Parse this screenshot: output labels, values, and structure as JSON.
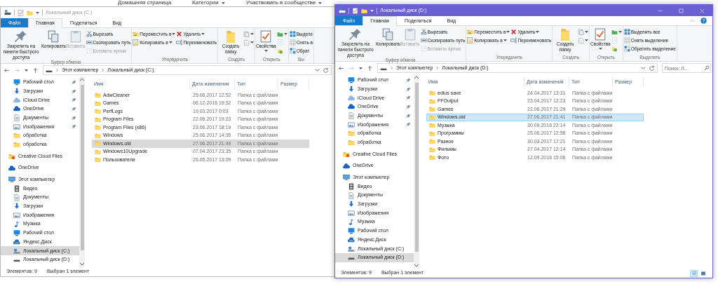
{
  "background_page": {
    "links": [
      {
        "label": "Домашняя страница",
        "dropdown": false
      },
      {
        "label": "Категории",
        "dropdown": true
      },
      {
        "label": "Участвовать в сообществе",
        "dropdown": true
      }
    ]
  },
  "windows": [
    {
      "title": "Локальный диск (C:)",
      "active": false,
      "caption_buttons": false,
      "tabs": [
        {
          "label": "Файл",
          "kind": "file",
          "selected": false
        },
        {
          "label": "Главная",
          "kind": "tab",
          "selected": true
        },
        {
          "label": "Поделиться",
          "kind": "tab",
          "selected": false
        },
        {
          "label": "Вид",
          "kind": "tab",
          "selected": false
        }
      ],
      "ribbon": {
        "groups": [
          {
            "label": "Буфер обмена",
            "columns": [
              [
                {
                  "kind": "pin",
                  "label": "Закрепить на панели быстрого доступа",
                  "disabled": false,
                  "dropdown": false
                }
              ],
              [
                {
                  "kind": "copy",
                  "label": "Копировать",
                  "disabled": false,
                  "dropdown": false
                }
              ],
              [
                {
                  "kind": "paste",
                  "label": "Вставить",
                  "disabled": true,
                  "dropdown": false
                }
              ],
              [
                {
                  "kind": "cut",
                  "label": "Вырезать",
                  "disabled": false,
                  "dropdown": false
                },
                {
                  "kind": "copypath",
                  "label": "Скопировать путь",
                  "disabled": false,
                  "dropdown": false
                },
                {
                  "kind": "shortcut",
                  "label": "Вставить ярлык",
                  "disabled": true,
                  "dropdown": false
                }
              ]
            ]
          },
          {
            "label": "Упорядочить",
            "columns": [
              [
                {
                  "kind": "move",
                  "label": "Переместить в",
                  "disabled": false,
                  "dropdown": true
                },
                {
                  "kind": "copyto",
                  "label": "Копировать в",
                  "disabled": false,
                  "dropdown": true
                }
              ],
              [
                {
                  "kind": "delete",
                  "label": "Удалить",
                  "disabled": false,
                  "dropdown": true
                },
                {
                  "kind": "rename",
                  "label": "Переименовать",
                  "disabled": false,
                  "dropdown": false
                }
              ]
            ]
          },
          {
            "label": "Создать",
            "columns": [
              [
                {
                  "kind": "newfolder",
                  "label": "Создать папку",
                  "disabled": false,
                  "dropdown": false
                }
              ],
              [
                {
                  "kind": "newitem",
                  "disabled": false,
                  "dropdown": true
                },
                {
                  "kind": "easyaccess",
                  "disabled": false,
                  "dropdown": true
                }
              ]
            ]
          },
          {
            "label": "Открыть",
            "columns": [
              [
                {
                  "kind": "properties",
                  "label": "Свойства",
                  "disabled": false,
                  "dropdown": true
                }
              ],
              [
                {
                  "kind": "open",
                  "disabled": false,
                  "dropdown": true
                },
                {
                  "kind": "edit",
                  "disabled": true,
                  "dropdown": false
                },
                {
                  "kind": "history",
                  "disabled": false,
                  "dropdown": false
                }
              ]
            ]
          },
          {
            "label": "Вы",
            "columns": [
              [
                {
                  "kind": "selectall",
                  "label": "Выделе",
                  "disabled": false,
                  "dropdown": false
                },
                {
                  "kind": "selectnone",
                  "label": "Снять в",
                  "disabled": false,
                  "dropdown": false
                },
                {
                  "kind": "invert",
                  "label": "Обрат",
                  "disabled": false,
                  "dropdown": false
                }
              ]
            ]
          }
        ]
      },
      "address": {
        "path": [
          "Этот компьютер",
          "Локальный диск (C:)"
        ]
      },
      "navigation": {
        "quick_access": [
          {
            "label": "Рабочий стол",
            "kind": "desktop",
            "pinned": true,
            "selected": false
          },
          {
            "label": "Загрузки",
            "kind": "downloads",
            "pinned": true,
            "selected": false
          },
          {
            "label": "iCloud Drive",
            "kind": "icloud",
            "pinned": true,
            "selected": false
          },
          {
            "label": "OneDrive",
            "kind": "onedrive",
            "pinned": true,
            "selected": false
          },
          {
            "label": "Документы",
            "kind": "documents",
            "pinned": true,
            "selected": false
          },
          {
            "label": "Изображения",
            "kind": "pictures",
            "pinned": true,
            "selected": false
          },
          {
            "label": "обработка",
            "kind": "folder",
            "pinned": false,
            "selected": false
          },
          {
            "label": "обработка",
            "kind": "folder",
            "pinned": false,
            "selected": false
          }
        ],
        "roots": [
          {
            "label": "Creative Cloud Files",
            "kind": "creativecloud",
            "selected": false
          },
          {
            "label": "OneDrive",
            "kind": "onedrive",
            "selected": false
          },
          {
            "label": "Этот компьютер",
            "kind": "computer",
            "selected": false,
            "children": [
              {
                "label": "Видео",
                "kind": "video",
                "selected": false
              },
              {
                "label": "Документы",
                "kind": "documents",
                "selected": false
              },
              {
                "label": "Загрузки",
                "kind": "downloads",
                "selected": false
              },
              {
                "label": "Изображения",
                "kind": "pictures",
                "selected": false
              },
              {
                "label": "Музыка",
                "kind": "music",
                "selected": false
              },
              {
                "label": "Рабочий стол",
                "kind": "desktop",
                "selected": false
              },
              {
                "label": "Яндекс.Диск",
                "kind": "yandex",
                "selected": false
              },
              {
                "label": "Локальный диск (C:)",
                "kind": "systemdrive",
                "selected": true
              },
              {
                "label": "Локальный диск (D:)",
                "kind": "drive",
                "selected": false
              }
            ]
          }
        ]
      },
      "files": {
        "columns": [
          "Имя",
          "Дата изменения",
          "Тип",
          "Размер"
        ],
        "rows": [
          {
            "name": "AdwCleaner",
            "date": "25.06.2017 12:52",
            "type": "Папка с файлами",
            "selected": false
          },
          {
            "name": "Games",
            "date": "06.12.2016 19:32",
            "type": "Папка с файлами",
            "selected": false
          },
          {
            "name": "PerfLogs",
            "date": "19.03.2017 0:03",
            "type": "Папка с файлами",
            "selected": false
          },
          {
            "name": "Program Files",
            "date": "22.06.2017 19:23",
            "type": "Папка с файлами",
            "selected": false
          },
          {
            "name": "Program Files (x86)",
            "date": "23.06.2017 18:19",
            "type": "Папка с файлами",
            "selected": false
          },
          {
            "name": "Windows",
            "date": "25.06.2017 14:35",
            "type": "Папка с файлами",
            "selected": false
          },
          {
            "name": "Windows.old",
            "date": "27.06.2017 21:49",
            "type": "Папка с файлами",
            "selected": true
          },
          {
            "name": "Windows10Upgrade",
            "date": "07.04.2017 23:35",
            "type": "Папка с файлами",
            "selected": false
          },
          {
            "name": "Пользователи",
            "date": "26.05.2017 13:09",
            "type": "Папка с файлами",
            "selected": false
          }
        ]
      },
      "status": {
        "count": "Элементов: 9",
        "selection": "Выбран 1 элемент"
      }
    },
    {
      "title": "Локальный диск (D:)",
      "active": true,
      "caption_buttons": true,
      "tabs": [
        {
          "label": "Файл",
          "kind": "file",
          "selected": false
        },
        {
          "label": "Главная",
          "kind": "tab",
          "selected": true
        },
        {
          "label": "Поделиться",
          "kind": "tab",
          "selected": false
        },
        {
          "label": "Вид",
          "kind": "tab",
          "selected": false
        }
      ],
      "ribbon": {
        "groups": [
          {
            "label": "Буфер обмена",
            "columns": [
              [
                {
                  "kind": "pin",
                  "label": "Закрепить на панели быстрого доступа",
                  "disabled": false,
                  "dropdown": false
                }
              ],
              [
                {
                  "kind": "copy",
                  "label": "Копировать",
                  "disabled": false,
                  "dropdown": false
                }
              ],
              [
                {
                  "kind": "paste",
                  "label": "Вставить",
                  "disabled": true,
                  "dropdown": false
                }
              ],
              [
                {
                  "kind": "cut",
                  "label": "Вырезать",
                  "disabled": false,
                  "dropdown": false
                },
                {
                  "kind": "copypath",
                  "label": "Скопировать путь",
                  "disabled": false,
                  "dropdown": false
                },
                {
                  "kind": "shortcut",
                  "label": "Вставить ярлык",
                  "disabled": true,
                  "dropdown": false
                }
              ]
            ]
          },
          {
            "label": "Упорядочить",
            "columns": [
              [
                {
                  "kind": "move",
                  "label": "Переместить в",
                  "disabled": false,
                  "dropdown": true
                },
                {
                  "kind": "copyto",
                  "label": "Копировать в",
                  "disabled": false,
                  "dropdown": true
                }
              ],
              [
                {
                  "kind": "delete",
                  "label": "Удалить",
                  "disabled": false,
                  "dropdown": true
                },
                {
                  "kind": "rename",
                  "label": "Переименовать",
                  "disabled": false,
                  "dropdown": false
                }
              ]
            ]
          },
          {
            "label": "Создать",
            "columns": [
              [
                {
                  "kind": "newfolder",
                  "label": "Создать папку",
                  "disabled": false,
                  "dropdown": false
                }
              ],
              [
                {
                  "kind": "newitem",
                  "disabled": false,
                  "dropdown": true
                },
                {
                  "kind": "easyaccess",
                  "disabled": false,
                  "dropdown": true
                }
              ]
            ]
          },
          {
            "label": "Открыть",
            "columns": [
              [
                {
                  "kind": "properties",
                  "label": "Свойства",
                  "disabled": false,
                  "dropdown": true
                }
              ],
              [
                {
                  "kind": "open",
                  "disabled": false,
                  "dropdown": true
                },
                {
                  "kind": "edit",
                  "disabled": true,
                  "dropdown": false
                },
                {
                  "kind": "history",
                  "disabled": false,
                  "dropdown": false
                }
              ]
            ]
          },
          {
            "label": "Выделить",
            "columns": [
              [
                {
                  "kind": "selectall",
                  "label": "Выделить все",
                  "disabled": false,
                  "dropdown": false
                },
                {
                  "kind": "selectnone",
                  "label": "Снять выделение",
                  "disabled": false,
                  "dropdown": false
                },
                {
                  "kind": "invert",
                  "label": "Обратить выделение",
                  "disabled": false,
                  "dropdown": false
                }
              ]
            ]
          }
        ]
      },
      "address": {
        "path": [
          "Этот компьютер",
          "Локальный диск (D:)"
        ]
      },
      "search": {
        "placeholder": "Поиск: Л..."
      },
      "navigation": {
        "quick_access": [
          {
            "label": "Рабочий стол",
            "kind": "desktop",
            "pinned": true,
            "selected": false
          },
          {
            "label": "Загрузки",
            "kind": "downloads",
            "pinned": true,
            "selected": false
          },
          {
            "label": "iCloud Drive",
            "kind": "icloud",
            "pinned": true,
            "selected": false
          },
          {
            "label": "OneDrive",
            "kind": "onedrive",
            "pinned": true,
            "selected": false
          },
          {
            "label": "Документы",
            "kind": "documents",
            "pinned": true,
            "selected": false
          },
          {
            "label": "Изображения",
            "kind": "pictures",
            "pinned": true,
            "selected": false
          },
          {
            "label": "обработка",
            "kind": "folder",
            "pinned": false,
            "selected": false
          },
          {
            "label": "обработка",
            "kind": "folder",
            "pinned": false,
            "selected": false
          }
        ],
        "roots": [
          {
            "label": "Creative Cloud Files",
            "kind": "creativecloud",
            "selected": false
          },
          {
            "label": "OneDrive",
            "kind": "onedrive",
            "selected": false
          },
          {
            "label": "Этот компьютер",
            "kind": "computer",
            "selected": false,
            "children": [
              {
                "label": "Видео",
                "kind": "video",
                "selected": false
              },
              {
                "label": "Документы",
                "kind": "documents",
                "selected": false
              },
              {
                "label": "Загрузки",
                "kind": "downloads",
                "selected": false
              },
              {
                "label": "Изображения",
                "kind": "pictures",
                "selected": false
              },
              {
                "label": "Музыка",
                "kind": "music",
                "selected": false
              },
              {
                "label": "Рабочий стол",
                "kind": "desktop",
                "selected": false
              },
              {
                "label": "Яндекс.Диск",
                "kind": "yandex",
                "selected": false
              },
              {
                "label": "Локальный диск (C:)",
                "kind": "systemdrive",
                "selected": false
              },
              {
                "label": "Локальный диск (D:)",
                "kind": "drive",
                "selected": true
              }
            ]
          }
        ]
      },
      "files": {
        "columns": [
          "Имя",
          "Дата изменения",
          "Тип",
          "Размер"
        ],
        "rows": [
          {
            "name": "edius save",
            "date": "24.04.2017 13:31",
            "type": "Папка с файлами",
            "selected": false
          },
          {
            "name": "FFOutput",
            "date": "23.04.2017 12:23",
            "type": "Папка с файлами",
            "selected": false
          },
          {
            "name": "Games",
            "date": "22.06.2017 21:29",
            "type": "Папка с файлами",
            "selected": false
          },
          {
            "name": "Windows.old",
            "date": "27.06.2017 21:41",
            "type": "Папка с файлами",
            "selected": true
          },
          {
            "name": "Музыка",
            "date": "30.09.2016 22:14",
            "type": "Папка с файлами",
            "selected": false
          },
          {
            "name": "Программы",
            "date": "25.06.2017 12:58",
            "type": "Папка с файлами",
            "selected": false
          },
          {
            "name": "Разное",
            "date": "30.03.2017 17:21",
            "type": "Папка с файлами",
            "selected": false
          },
          {
            "name": "Фильмы",
            "date": "27.04.2017 12:14",
            "type": "Папка с файлами",
            "selected": false
          },
          {
            "name": "Фото",
            "date": "12.09.2016 15:06",
            "type": "Папка с файлами",
            "selected": false
          }
        ]
      },
      "status": {
        "count": "Элементов: 9",
        "selection": "Выбран 1 элемент"
      },
      "view_buttons": [
        {
          "kind": "details",
          "selected": true
        },
        {
          "kind": "tiles",
          "selected": false
        }
      ]
    }
  ]
}
